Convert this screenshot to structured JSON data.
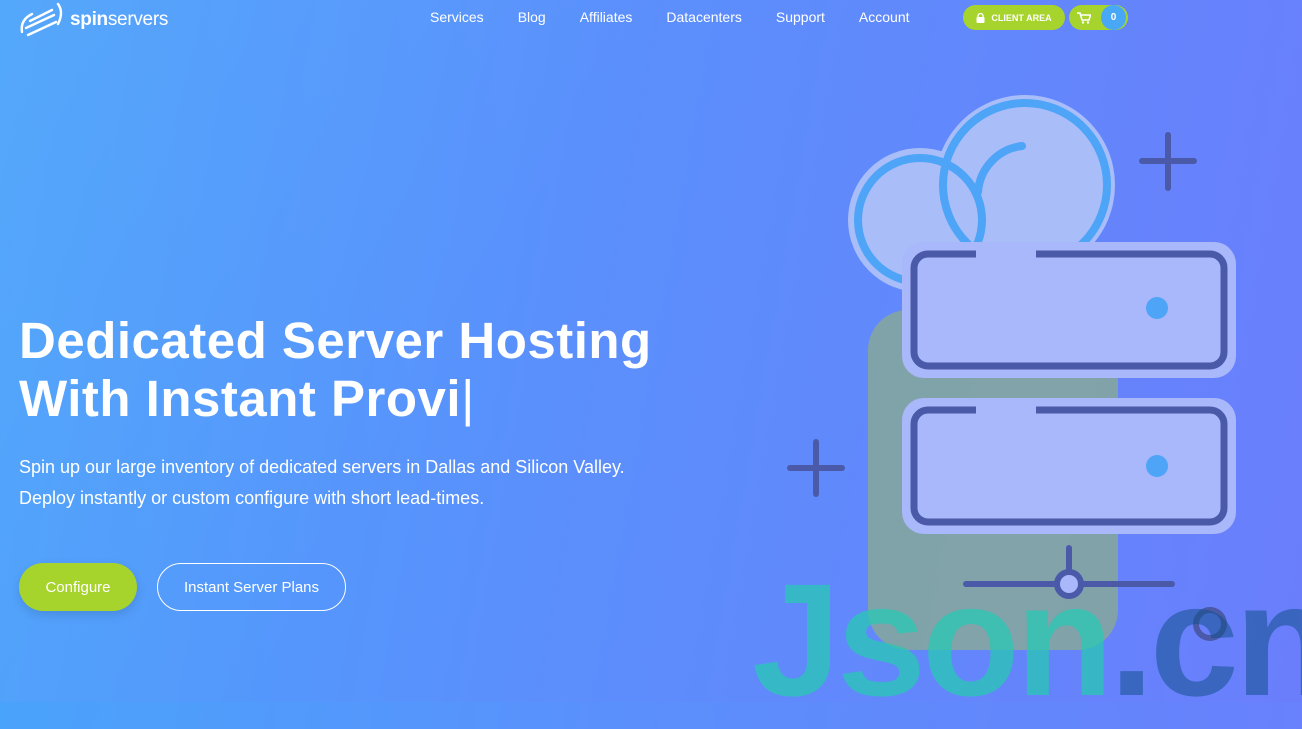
{
  "brand": {
    "logo_bold": "spin",
    "logo_thin": "servers"
  },
  "nav": {
    "items": [
      "Services",
      "Blog",
      "Affiliates",
      "Datacenters",
      "Support",
      "Account"
    ],
    "client_area": "CLIENT AREA",
    "cart_count": "0"
  },
  "hero": {
    "title_line1": "Dedicated Server Hosting",
    "title_line2": "With Instant Provi",
    "cursor": "|",
    "subtitle_line1": "Spin up our large inventory of dedicated servers in Dallas and Silicon Valley.",
    "subtitle_line2": "Deploy instantly or custom configure with short lead-times.",
    "primary_button": "Configure",
    "secondary_button": "Instant Server Plans"
  },
  "watermark": {
    "part1": "Json",
    "part2": ".cn"
  },
  "colors": {
    "accent_green": "#a6d32c",
    "badge_blue": "#49a8f5",
    "bg_start": "#4aa3fb",
    "bg_end": "#6a7efc"
  }
}
